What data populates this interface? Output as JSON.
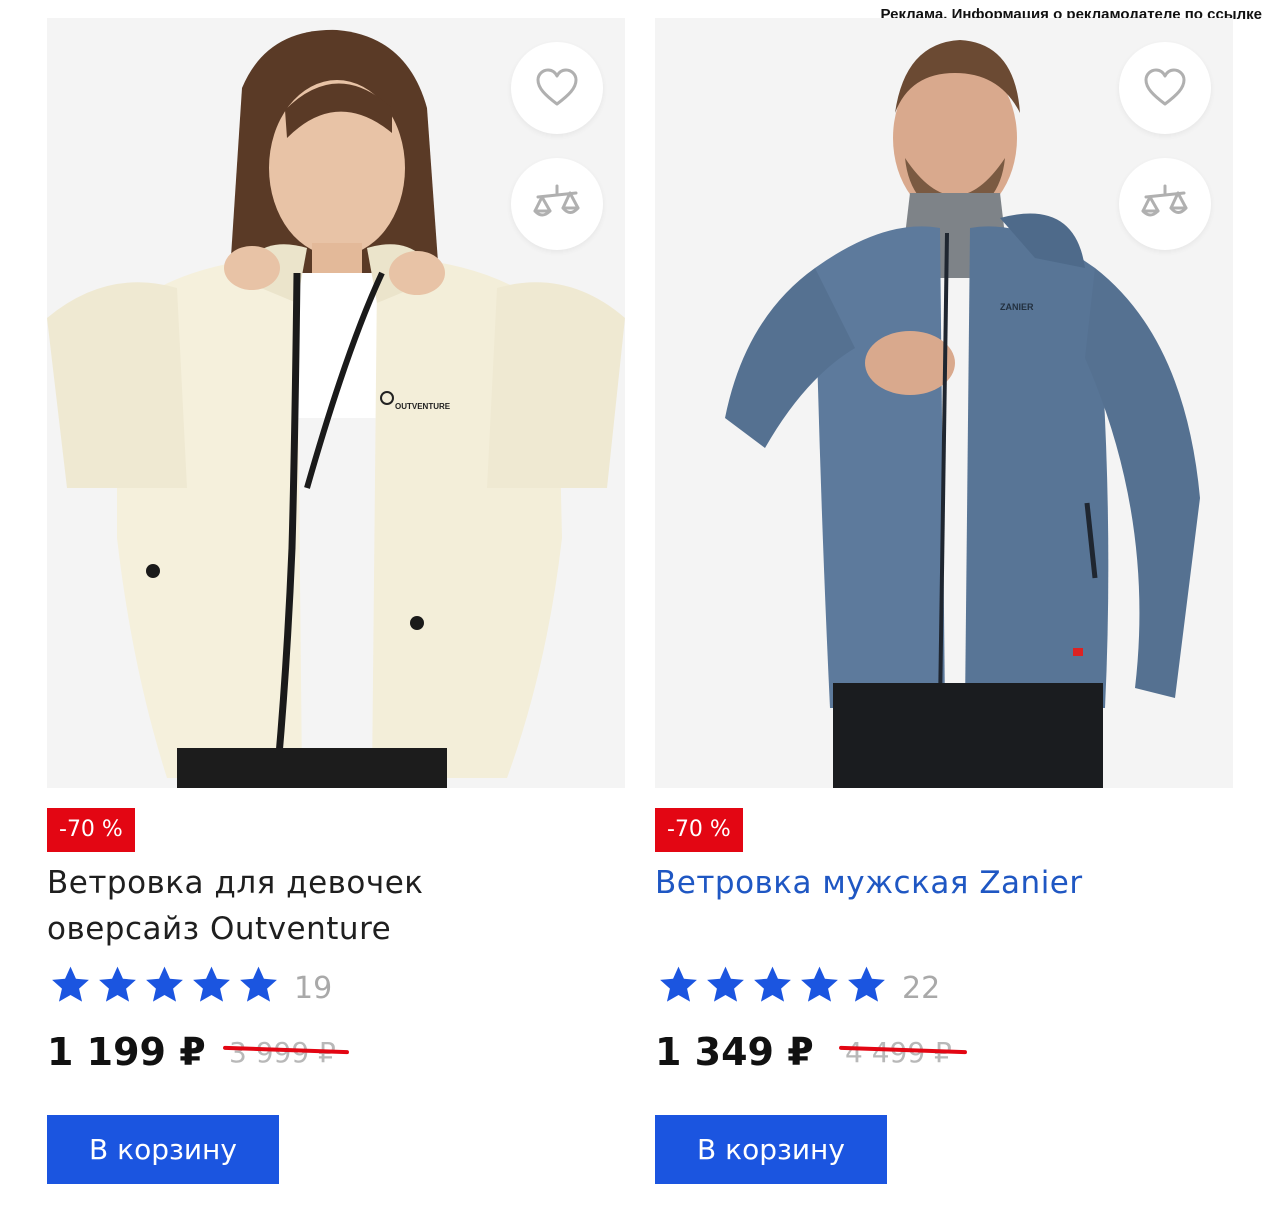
{
  "ad_notice": "Реклама. Информация о рекламодателе по ссылке",
  "colors": {
    "accent_blue": "#1b55e0",
    "link_blue": "#1f57c3",
    "discount_red": "#e30613",
    "star_blue": "#1b55e0"
  },
  "products": [
    {
      "discount": "-70 %",
      "title_line1": "Ветровка для девочек",
      "title_line2": "оверсайз Outventure",
      "rating_stars": 5,
      "reviews": "19",
      "price": "1 199 ₽",
      "old_price": "3 999 ₽",
      "cart_label": "В корзину",
      "jacket_brand": "OUTVENTURE",
      "icons": [
        "heart-icon",
        "scales-icon"
      ]
    },
    {
      "discount": "-70 %",
      "title_line1": "Ветровка мужская Zanier",
      "rating_stars": 5,
      "reviews": "22",
      "price": "1 349 ₽",
      "old_price": "4 499 ₽",
      "cart_label": "В корзину",
      "jacket_brand": "ZANIER",
      "icons": [
        "heart-icon",
        "scales-icon"
      ]
    }
  ]
}
